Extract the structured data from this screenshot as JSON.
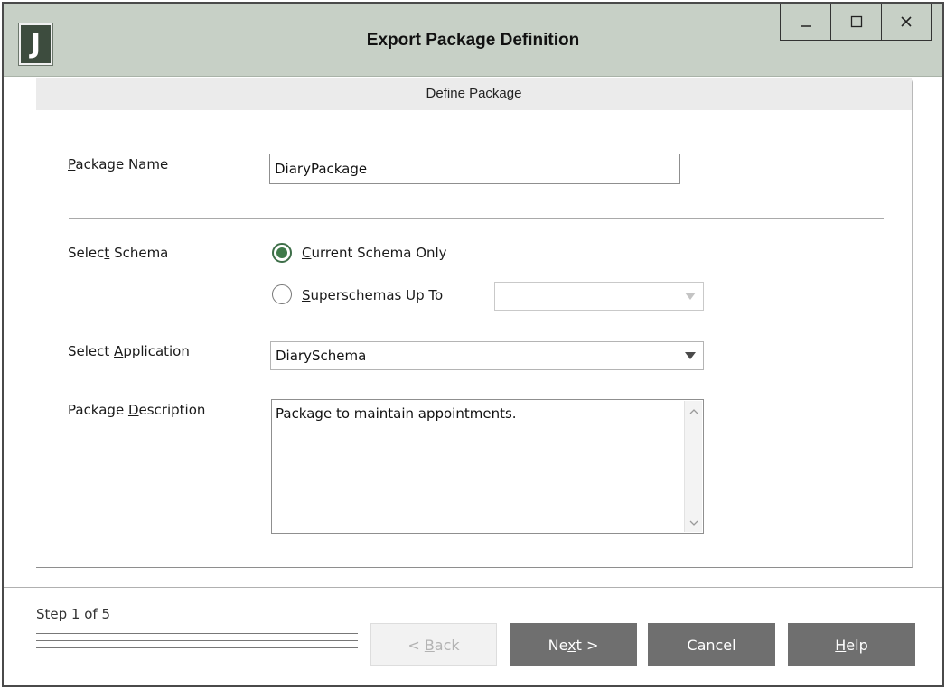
{
  "window": {
    "logo_letter": "J",
    "title": "Export Package Definition",
    "controls": [
      "minimize-icon",
      "maximize-icon",
      "close-icon"
    ]
  },
  "section": {
    "header": "Define Package"
  },
  "fields": {
    "package_name": {
      "label_pre": "",
      "label_mnemonic": "P",
      "label_post": "ackage Name",
      "value": "DiaryPackage"
    },
    "select_schema": {
      "label_pre": "Selec",
      "label_mnemonic": "t",
      "label_post": " Schema",
      "options": [
        {
          "mnemonic": "C",
          "rest": "urrent Schema Only",
          "checked": true
        },
        {
          "mnemonic": "S",
          "rest": "uperschemas Up To",
          "checked": false
        }
      ],
      "superschema_value": ""
    },
    "select_application": {
      "label_pre": "Select ",
      "label_mnemonic": "A",
      "label_post": "pplication",
      "value": "DiarySchema"
    },
    "package_description": {
      "label_pre": "Package ",
      "label_mnemonic": "D",
      "label_post": "escription",
      "value": "Package to maintain appointments."
    }
  },
  "footer": {
    "step": "Step 1 of 5",
    "buttons": {
      "back": {
        "pre": "< ",
        "mnemonic": "B",
        "post": "ack"
      },
      "next": {
        "pre": "Ne",
        "mnemonic": "x",
        "post": "t >"
      },
      "cancel": {
        "label": "Cancel"
      },
      "help": {
        "pre": "",
        "mnemonic": "H",
        "post": "elp"
      }
    }
  },
  "colors": {
    "titlebar": "#c7d0c6",
    "logo": "#3d4c3e",
    "radio_accent": "#3f7a4a",
    "button_primary": "#6f6f6f",
    "button_disabled": "#f2f2f2"
  }
}
